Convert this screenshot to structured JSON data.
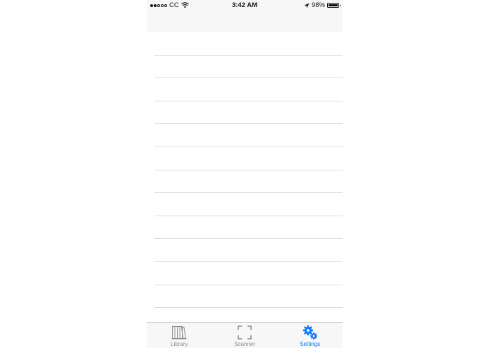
{
  "status_bar": {
    "signal_filled": 2,
    "signal_total": 5,
    "carrier": "CC",
    "time": "3:42 AM",
    "battery": "98%",
    "battery_level": 0.98
  },
  "nav_bar": {
    "title": ""
  },
  "table": {
    "row_count": 12
  },
  "tab_bar": {
    "tabs": [
      {
        "label": "Library",
        "icon": "books-icon",
        "active": false
      },
      {
        "label": "Scanner",
        "icon": "scan-frame-icon",
        "active": false
      },
      {
        "label": "Settings",
        "icon": "gears-icon",
        "active": true
      }
    ]
  },
  "colors": {
    "accent": "#0a7aff",
    "inactive": "#8e8e93",
    "bar_background": "#f7f7f7",
    "separator": "#dcdcdc"
  }
}
